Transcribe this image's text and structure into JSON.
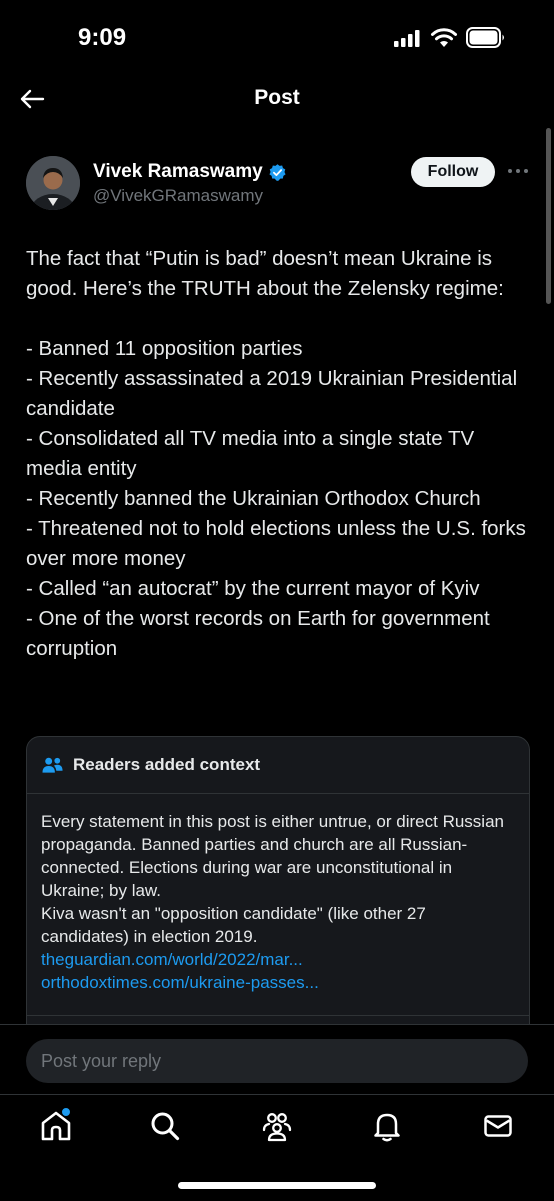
{
  "status_bar": {
    "time": "9:09"
  },
  "header": {
    "title": "Post"
  },
  "author": {
    "display_name": "Vivek Ramaswamy",
    "handle": "@VivekGRamaswamy",
    "verified": true
  },
  "follow_label": "Follow",
  "post": {
    "intro": "The fact that “Putin is bad” doesn’t mean Ukraine is good.  Here’s the TRUTH about the Zelensky regime:",
    "points": [
      "- Banned 11 opposition parties",
      "- Recently assassinated a 2019 Ukrainian Presidential candidate",
      "- Consolidated all TV media into a single state TV media entity",
      "- Recently banned the Ukrainian Orthodox Church",
      "- Threatened not to hold elections unless the U.S. forks over more money",
      "- Called “an autocrat” by the current mayor of Kyiv",
      "- One of the worst records on Earth for government corruption"
    ]
  },
  "community_note": {
    "title": "Readers added context",
    "text_1": "Every statement in this post is either untrue, or direct Russian propaganda. Banned parties and church are all Russian-connected. Elections during war are unconstitutional in Ukraine; by law.",
    "text_2": "Kiva wasn't an \"opposition candidate\" (like other 27 candidates) in election 2019.",
    "links": [
      "theguardian.com/world/2022/mar...",
      "orthodoxtimes.com/ukraine-passes..."
    ]
  },
  "reply": {
    "placeholder": "Post your reply"
  },
  "tabs": [
    "home-icon",
    "search-icon",
    "communities-icon",
    "notifications-icon",
    "messages-icon"
  ],
  "colors": {
    "accent": "#1d9bf0",
    "background": "#000000",
    "text": "#e7e9ea",
    "secondary_text": "#71767b"
  }
}
